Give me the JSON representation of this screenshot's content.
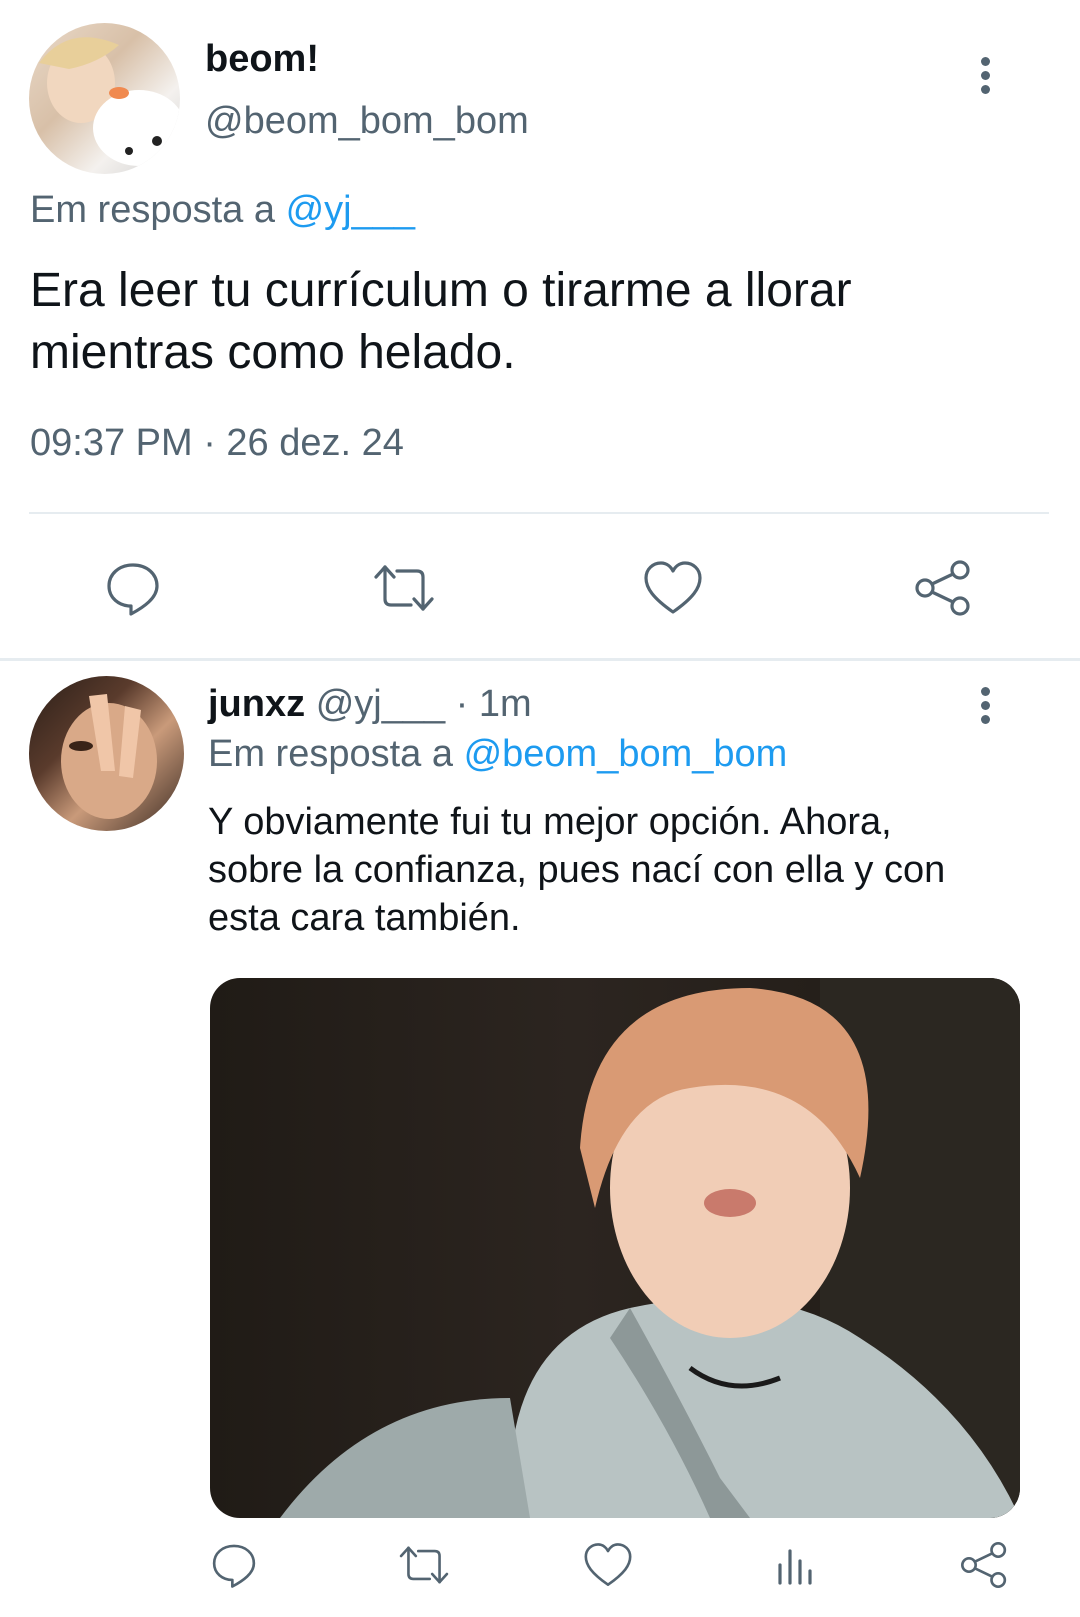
{
  "tweet1": {
    "display_name": "beom!",
    "handle": "@beom_bom_bom",
    "reply_prefix": "Em resposta a ",
    "reply_to": "@yj___",
    "text_line1": "Era leer tu currículum o tirarme a llorar",
    "text_line2": "mientras como helado.",
    "timestamp": "09:37 PM · 26 dez. 24",
    "avatar_icon": "avatar-photo"
  },
  "tweet2": {
    "display_name": "junxz",
    "handle": "@yj___",
    "time_separator": " · 1m",
    "reply_prefix": "Em resposta a ",
    "reply_to": "@beom_bom_bom",
    "text_line1": "Y obviamente fui tu mejor opción. Ahora,",
    "text_line2": "sobre la confianza, pues nací con ella y con",
    "text_line3": "esta cara también.",
    "media_icon": "photo-media"
  },
  "icons": [
    "reply-icon",
    "retweet-icon",
    "like-icon",
    "share-icon",
    "more-icon",
    "analytics-icon"
  ],
  "colors": {
    "text": "#0f1419",
    "muted": "#536471",
    "link": "#1d9bf0",
    "divider": "#eff3f4"
  }
}
